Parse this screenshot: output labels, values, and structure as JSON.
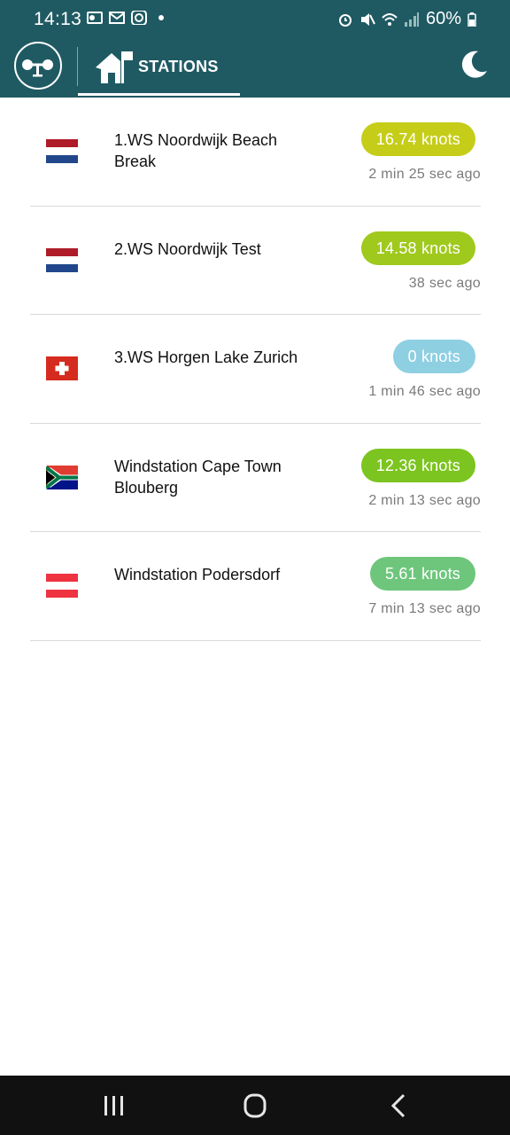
{
  "status_bar": {
    "time": "14:13",
    "battery": "60%",
    "left_icons": [
      "outlook-icon",
      "mail-icon",
      "instagram-icon",
      "dot-icon"
    ],
    "right_icons": [
      "alarm-icon",
      "mute-icon",
      "wifi-icon",
      "signal-icon",
      "battery-icon"
    ]
  },
  "app_bar": {
    "logo_icon": "windstation-logo-icon",
    "tab_label": "STATIONS",
    "tab_icon": "home-flag-icon",
    "theme_icon": "moon-icon",
    "background": "#1f5a63"
  },
  "stations": [
    {
      "flag": "netherlands",
      "name": "1.WS Noordwijk Beach Break",
      "wind": "16.74 knots",
      "color": "#c5cd18",
      "updated": "2 min 25 sec ago"
    },
    {
      "flag": "netherlands",
      "name": "2.WS Noordwijk Test",
      "wind": "14.58 knots",
      "color": "#9fc91d",
      "updated": "38 sec ago"
    },
    {
      "flag": "switzerland",
      "name": "3.WS Horgen Lake Zurich",
      "wind": "0 knots",
      "color": "#8ecfe2",
      "updated": "1 min 46 sec ago"
    },
    {
      "flag": "south-africa",
      "name": "Windstation Cape Town Blouberg",
      "wind": "12.36 knots",
      "color": "#7cc41f",
      "updated": "2 min 13 sec ago"
    },
    {
      "flag": "austria",
      "name": "Windstation Podersdorf",
      "wind": "5.61 knots",
      "color": "#6ec67c",
      "updated": "7 min 13 sec ago"
    }
  ],
  "nav_bar": {
    "buttons": [
      "recent-apps-icon",
      "home-icon",
      "back-icon"
    ]
  }
}
